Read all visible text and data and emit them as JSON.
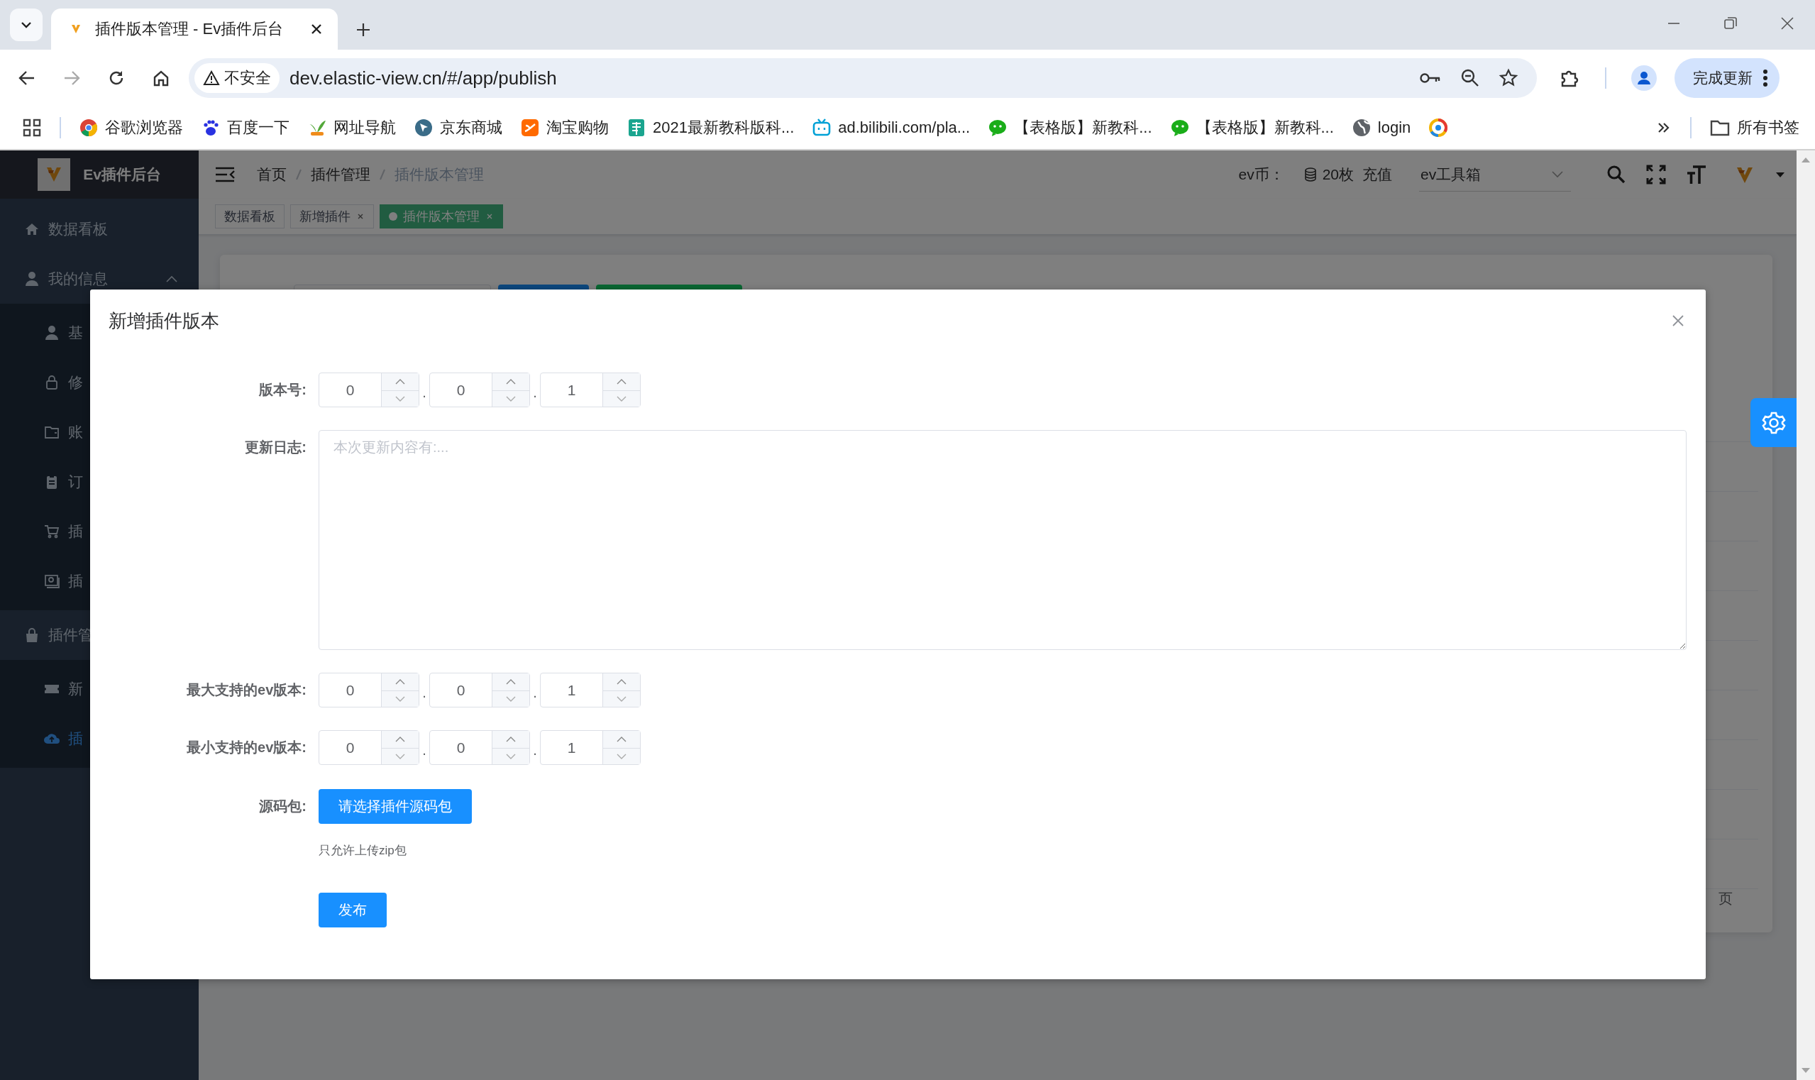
{
  "browser": {
    "tab": {
      "title": "插件版本管理 - Ev插件后台"
    },
    "security_chip": "不安全",
    "url": "dev.elastic-view.cn/#/app/publish",
    "update_button": "完成更新",
    "bookmarks": [
      "谷歌浏览器",
      "百度一下",
      "网址导航",
      "京东商城",
      "淘宝购物",
      "2021最新教科版科...",
      "ad.bilibili.com/pla...",
      "【表格版】新教科...",
      "【表格版】新教科...",
      "login"
    ],
    "all_bookmarks": "所有书签"
  },
  "app": {
    "brand": "Ev插件后台",
    "sidebar": {
      "items": [
        {
          "label": "数据看板",
          "selected": false
        },
        {
          "label": "我的信息",
          "selected": false,
          "expanded": true,
          "children": [
            {
              "label": "基",
              "selected": false
            },
            {
              "label": "修",
              "selected": false
            },
            {
              "label": "账",
              "selected": false
            },
            {
              "label": "订",
              "selected": false
            },
            {
              "label": "插",
              "selected": false
            },
            {
              "label": "插",
              "selected": false
            }
          ]
        },
        {
          "label": "插件管",
          "selected": false,
          "children": [
            {
              "label": "新",
              "selected": false
            },
            {
              "label": "插",
              "selected": true
            }
          ]
        }
      ]
    },
    "breadcrumb": [
      {
        "label": "首页",
        "current": false
      },
      {
        "label": "插件管理",
        "current": false
      },
      {
        "label": "插件版本管理",
        "current": true
      }
    ],
    "coin_label": "ev币：",
    "coin_amount": "20枚",
    "recharge": "充值",
    "toolbox_select": "ev工具箱",
    "tags": [
      {
        "label": "数据看板",
        "selected": false,
        "closable": false
      },
      {
        "label": "新增插件",
        "selected": false,
        "closable": true
      },
      {
        "label": "插件版本管理",
        "selected": true,
        "closable": true
      }
    ],
    "background_pagination": "页"
  },
  "dialog": {
    "title": "新增插件版本",
    "form": [
      {
        "kind": "version",
        "label": "版本号:",
        "parts": [
          "0",
          "0",
          "1"
        ],
        "separators": [
          ".",
          "."
        ]
      },
      {
        "kind": "textarea",
        "label": "更新日志:",
        "placeholder": "本次更新内容有:..."
      },
      {
        "kind": "version",
        "label": "最大支持的ev版本:",
        "parts": [
          "0",
          "0",
          "1"
        ],
        "separators": [
          ".",
          "."
        ]
      },
      {
        "kind": "version",
        "label": "最小支持的ev版本:",
        "parts": [
          "0",
          "0",
          "1"
        ],
        "separators": [
          ".",
          "."
        ]
      },
      {
        "kind": "upload",
        "label": "源码包:",
        "button": "请选择插件源码包",
        "hint": "只允许上传zip包"
      },
      {
        "kind": "submit",
        "button": "发布"
      }
    ]
  }
}
